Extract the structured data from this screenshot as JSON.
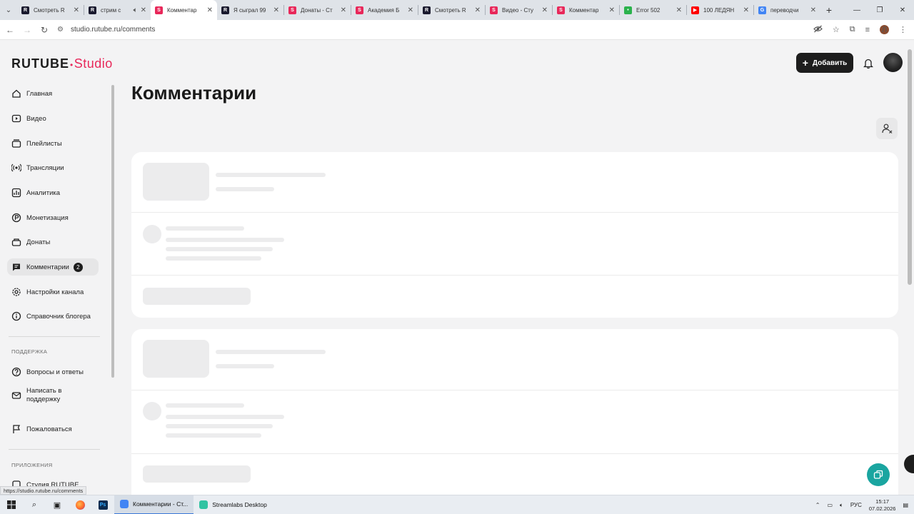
{
  "browser": {
    "tabs": [
      {
        "title": "Смотреть R",
        "favicon_color": "#1a1a2e",
        "favicon_letter": "R",
        "active": false,
        "audio": false
      },
      {
        "title": "стрим с",
        "favicon_color": "#1a1a2e",
        "favicon_letter": "R",
        "active": false,
        "audio": true
      },
      {
        "title": "Комментар",
        "favicon_color": "#e8285a",
        "favicon_letter": "S",
        "active": true,
        "audio": false
      },
      {
        "title": "Я сыграл 99",
        "favicon_color": "#1a1a2e",
        "favicon_letter": "R",
        "active": false,
        "audio": false
      },
      {
        "title": "Донаты - Ст",
        "favicon_color": "#e8285a",
        "favicon_letter": "S",
        "active": false,
        "audio": false
      },
      {
        "title": "Академия Б",
        "favicon_color": "#e8285a",
        "favicon_letter": "S",
        "active": false,
        "audio": false
      },
      {
        "title": "Смотреть R",
        "favicon_color": "#1a1a2e",
        "favicon_letter": "R",
        "active": false,
        "audio": false
      },
      {
        "title": "Видео - Сту",
        "favicon_color": "#e8285a",
        "favicon_letter": "S",
        "active": false,
        "audio": false
      },
      {
        "title": "Комментар",
        "favicon_color": "#e8285a",
        "favicon_letter": "S",
        "active": false,
        "audio": false
      },
      {
        "title": "Error 502",
        "favicon_color": "#2bb24c",
        "favicon_letter": "•",
        "active": false,
        "audio": false
      },
      {
        "title": "100 ЛЕДЯН",
        "favicon_color": "#ff0000",
        "favicon_letter": "▶",
        "active": false,
        "audio": false
      },
      {
        "title": "переводчи",
        "favicon_color": "#4285f4",
        "favicon_letter": "G",
        "active": false,
        "audio": false
      }
    ],
    "url": "studio.rutube.ru/comments",
    "profile_letter": "Л",
    "status_url": "https://studio.rutube.ru/comments"
  },
  "logo": {
    "part1": "RUTUBE",
    "part2": "Studio"
  },
  "header": {
    "add_label": "Добавить"
  },
  "page": {
    "title": "Комментарии"
  },
  "sidebar": {
    "items": [
      {
        "label": "Главная",
        "icon": "home-icon",
        "top": 0
      },
      {
        "label": "Видео",
        "icon": "video-icon",
        "top": 0
      },
      {
        "label": "Плейлисты",
        "icon": "playlist-icon",
        "top": 0
      },
      {
        "label": "Трансляции",
        "icon": "broadcast-icon",
        "top": 0
      },
      {
        "label": "Аналитика",
        "icon": "analytics-icon",
        "top": 0
      },
      {
        "label": "Монетизация",
        "icon": "monetization-icon",
        "top": 0
      },
      {
        "label": "Донаты",
        "icon": "donate-icon",
        "top": 0
      },
      {
        "label": "Комментарии",
        "icon": "comments-icon",
        "badge": "2",
        "active": true
      },
      {
        "label": "Настройки канала",
        "icon": "settings-icon"
      },
      {
        "label": "Справочник блогера",
        "icon": "info-icon"
      }
    ],
    "support_heading": "ПОДДЕРЖКА",
    "support_items": [
      {
        "label": "Вопросы и ответы",
        "icon": "help-icon"
      },
      {
        "label": "Написать в поддержку",
        "icon": "mail-icon"
      },
      {
        "label": "Пожаловаться",
        "icon": "flag-icon"
      }
    ],
    "apps_heading": "ПРИЛОЖЕНИЯ",
    "apps_items": [
      {
        "label": "Студия RUTUBE",
        "icon": "app-icon"
      }
    ]
  },
  "taskbar": {
    "apps": [
      {
        "label": "Комментарии - Ст...",
        "color": "#4285f4",
        "active": true
      },
      {
        "label": "Streamlabs Desktop",
        "color": "#31c3a2",
        "active": false
      }
    ],
    "lang": "РУС",
    "time": "15:17",
    "date": "07.02.2026"
  },
  "colors": {
    "brand": "#e8285a",
    "accent_dark": "#1d1d1d",
    "fab": "#1aa5a0"
  }
}
